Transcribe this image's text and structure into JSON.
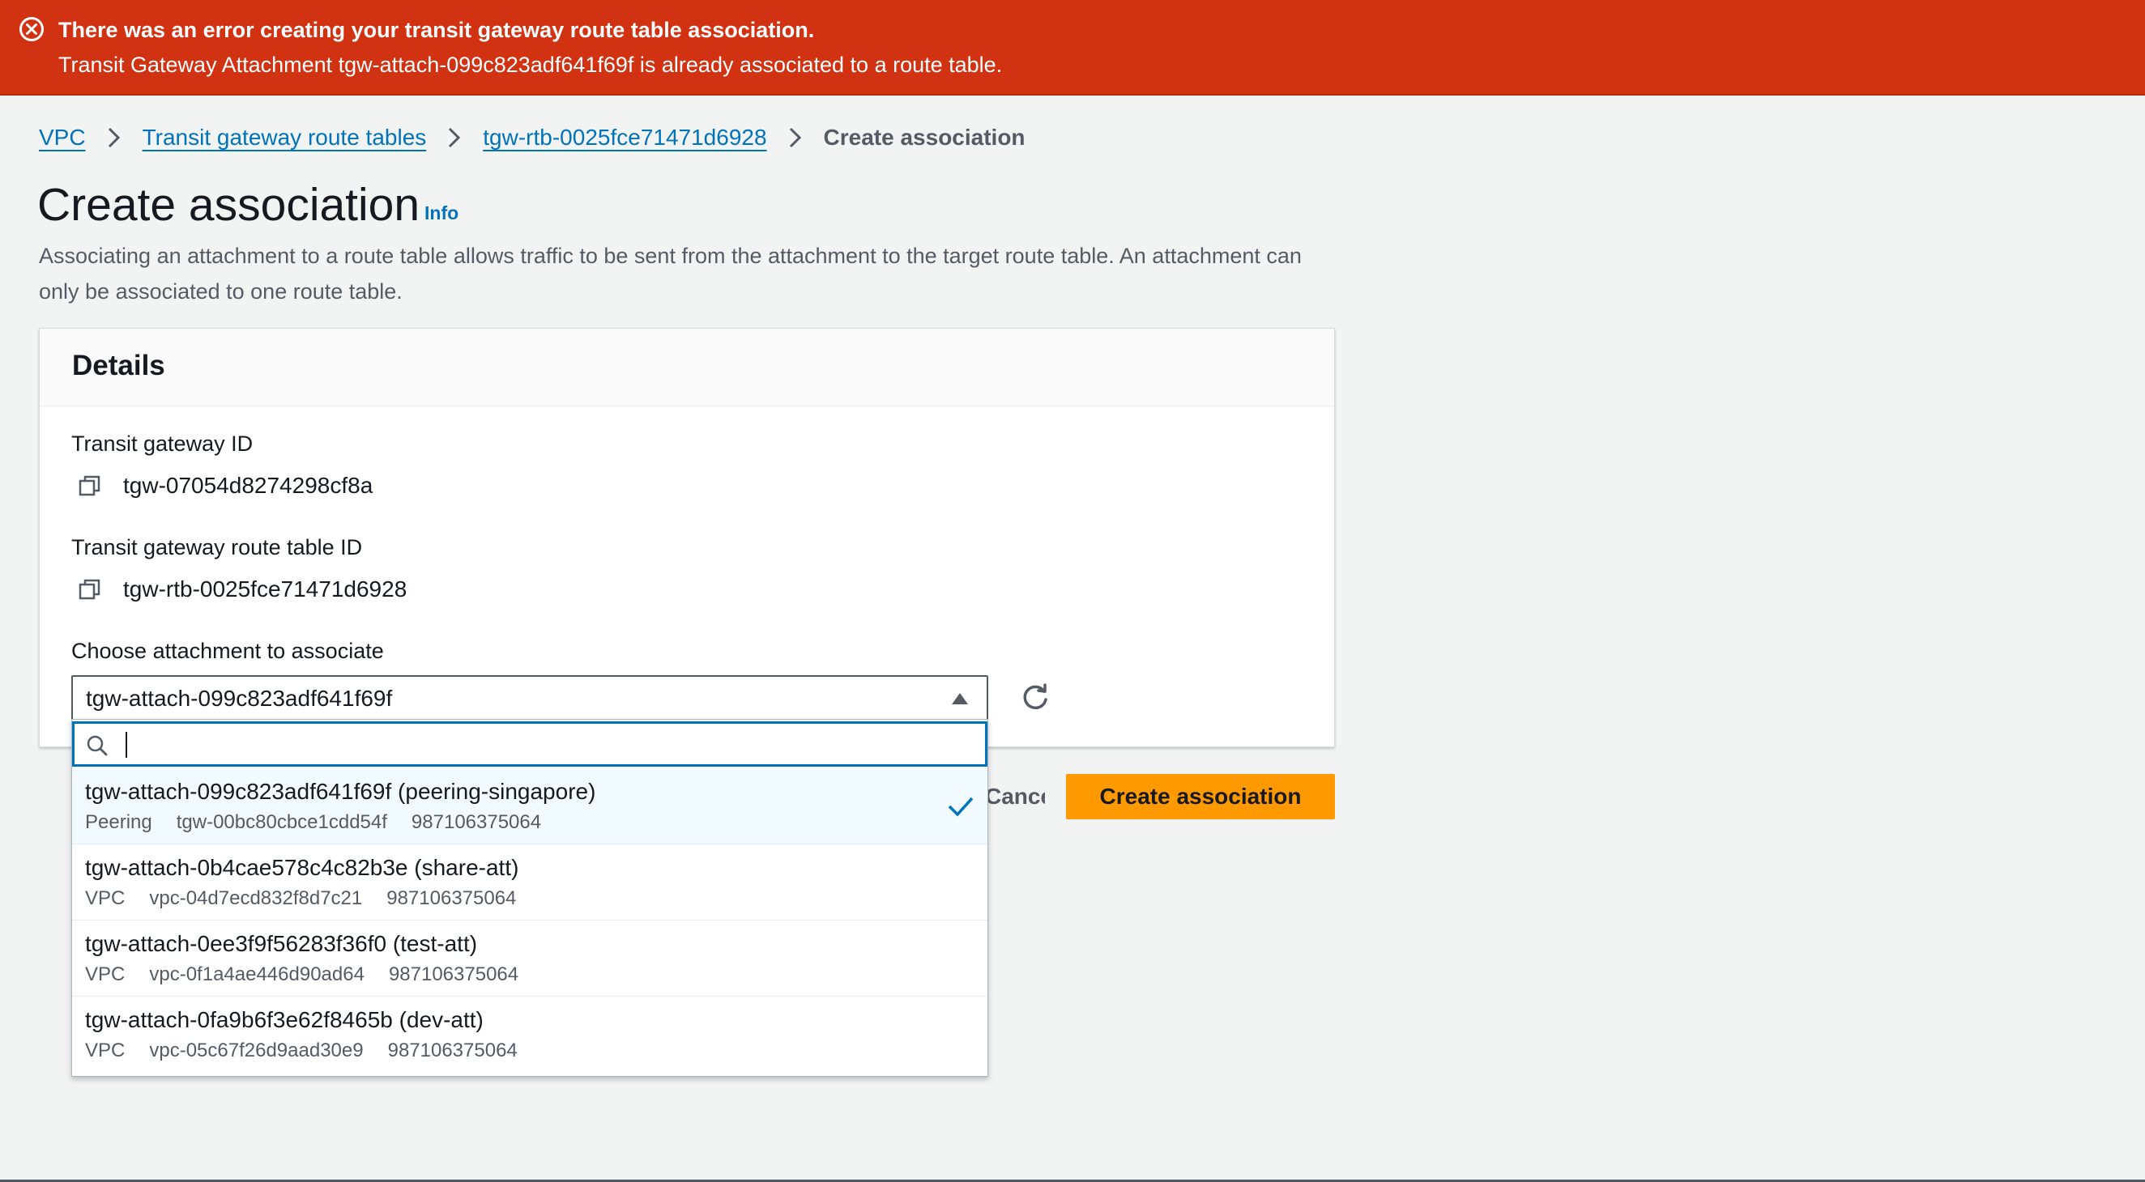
{
  "flash": {
    "title": "There was an error creating your transit gateway route table association.",
    "message": "Transit Gateway Attachment tgw-attach-099c823adf641f69f is already associated to a route table.",
    "icon": "error-circle-icon",
    "color": "#d13212"
  },
  "breadcrumb": {
    "items": [
      "VPC",
      "Transit gateway route tables",
      "tgw-rtb-0025fce71471d6928"
    ],
    "current": "Create association"
  },
  "page": {
    "title": "Create association",
    "info": "Info",
    "description": "Associating an attachment to a route table allows traffic to be sent from the attachment to the target route table. An attachment can only be associated to one route table."
  },
  "details": {
    "title": "Details",
    "tgw_label": "Transit gateway ID",
    "tgw_value": "tgw-07054d8274298cf8a",
    "rtb_label": "Transit gateway route table ID",
    "rtb_value": "tgw-rtb-0025fce71471d6928",
    "attach_label": "Choose attachment to associate",
    "attach_selected": "tgw-attach-099c823adf641f69f"
  },
  "dropdown": {
    "filter_value": "",
    "options": [
      {
        "label": "tgw-attach-099c823adf641f69f (peering-singapore)",
        "type": "Peering",
        "resource": "tgw-00bc80cbce1cdd54f",
        "account": "987106375064",
        "selected": true
      },
      {
        "label": "tgw-attach-0b4cae578c4c82b3e (share-att)",
        "type": "VPC",
        "resource": "vpc-04d7ecd832f8d7c21",
        "account": "987106375064",
        "selected": false
      },
      {
        "label": "tgw-attach-0ee3f9f56283f36f0 (test-att)",
        "type": "VPC",
        "resource": "vpc-0f1a4ae446d90ad64",
        "account": "987106375064",
        "selected": false
      },
      {
        "label": "tgw-attach-0fa9b6f3e62f8465b (dev-att)",
        "type": "VPC",
        "resource": "vpc-05c67f26d9aad30e9",
        "account": "987106375064",
        "selected": false
      }
    ]
  },
  "actions": {
    "cancel": "Cancel",
    "create": "Create association",
    "create_color": "#ff9900"
  }
}
